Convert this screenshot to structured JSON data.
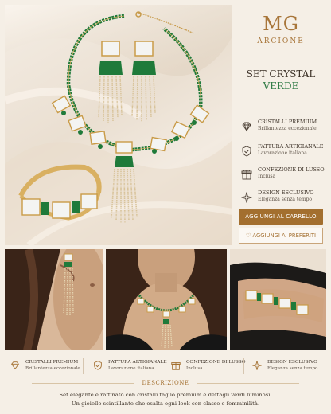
{
  "brand": {
    "mark": "MG",
    "name": "ARCIONE"
  },
  "product": {
    "title_line1": "SET CRYSTAL",
    "title_line2": "VERDE"
  },
  "features": [
    {
      "title": "CRISTALLI PREMIUM",
      "subtitle": "Brillantezza eccezionale",
      "icon": "diamond-icon"
    },
    {
      "title": "FATTURA ARTIGIANALE",
      "subtitle": "Lavorazione italiana",
      "icon": "shield-check-icon"
    },
    {
      "title": "CONFEZIONE DI LUSSO",
      "subtitle": "Inclusa",
      "icon": "gift-icon"
    },
    {
      "title": "DESIGN ESCLUSIVO",
      "subtitle": "Eleganza senza tempo",
      "icon": "sparkle-icon"
    }
  ],
  "actions": {
    "add_to_cart": "AGGIUNGI AL CARRELLO",
    "add_to_favorites": "AGGIUNGI AI PREFERITI"
  },
  "description": {
    "heading": "DESCRIZIONE",
    "line1": "Set elegante e raffinato con cristalli taglio premium e dettagli verdi luminosi.",
    "line2": "Un gioiello scintillante che esalta ogni look con classe e femminilità."
  },
  "colors": {
    "accent_gold": "#a36f2f",
    "emerald": "#1f7a3a",
    "background": "#f5efe6"
  }
}
